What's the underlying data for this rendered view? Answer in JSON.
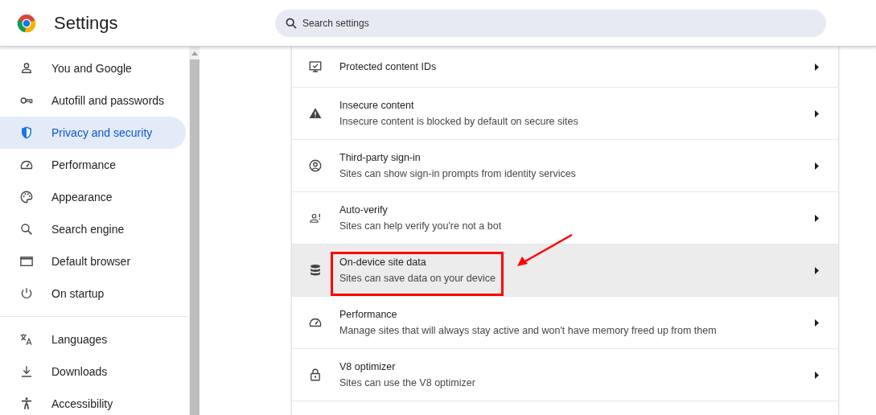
{
  "header": {
    "title": "Settings",
    "search": {
      "placeholder": "Search settings"
    }
  },
  "sidebar": {
    "groups": [
      [
        {
          "label": "You and Google",
          "selected": false
        },
        {
          "label": "Autofill and passwords",
          "selected": false
        },
        {
          "label": "Privacy and security",
          "selected": true
        },
        {
          "label": "Performance",
          "selected": false
        },
        {
          "label": "Appearance",
          "selected": false
        },
        {
          "label": "Search engine",
          "selected": false
        },
        {
          "label": "Default browser",
          "selected": false
        },
        {
          "label": "On startup",
          "selected": false
        }
      ],
      [
        {
          "label": "Languages",
          "selected": false
        },
        {
          "label": "Downloads",
          "selected": false
        },
        {
          "label": "Accessibility",
          "selected": false
        }
      ]
    ]
  },
  "settings": [
    {
      "title": "Protected content IDs",
      "highlighted": false,
      "annotated": false
    },
    {
      "title": "Insecure content",
      "description": "Insecure content is blocked by default on secure sites",
      "highlighted": false,
      "annotated": false
    },
    {
      "title": "Third-party sign-in",
      "description": "Sites can show sign-in prompts from identity services",
      "highlighted": false,
      "annotated": false
    },
    {
      "title": "Auto-verify",
      "description": "Sites can help verify you're not a bot",
      "highlighted": false,
      "annotated": false
    },
    {
      "title": "On-device site data",
      "description": "Sites can save data on your device",
      "highlighted": true,
      "annotated": true
    },
    {
      "title": "Performance",
      "description": "Manage sites that will always stay active and won't have memory freed up from them",
      "highlighted": false,
      "annotated": false
    },
    {
      "title": "V8 optimizer",
      "description": "Sites can use the V8 optimizer",
      "highlighted": false,
      "annotated": false
    }
  ]
}
